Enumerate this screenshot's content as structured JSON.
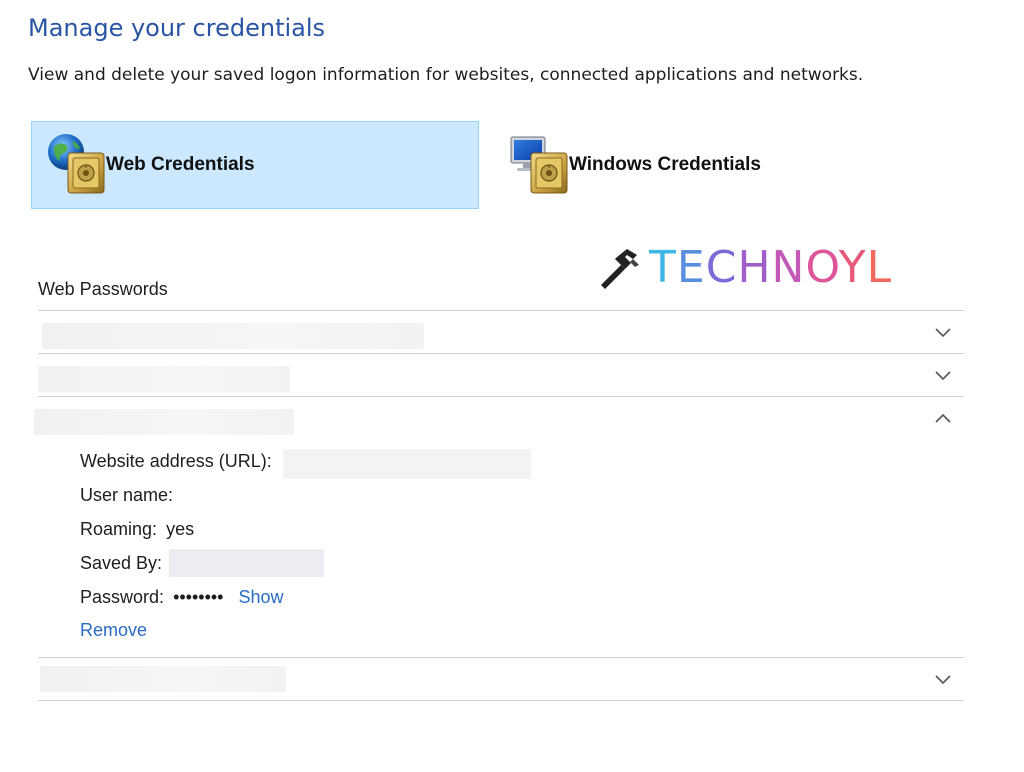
{
  "header": {
    "title": "Manage your credentials",
    "subtitle": "View and delete your saved logon information for websites, connected applications and networks."
  },
  "tiles": [
    {
      "label": "Web Credentials",
      "selected": true,
      "icon": "globe-vault-icon"
    },
    {
      "label": "Windows Credentials",
      "selected": false,
      "icon": "monitor-vault-icon"
    }
  ],
  "watermark": {
    "letters": [
      "T",
      "E",
      "C",
      "H",
      "N",
      "O",
      "Y",
      "L"
    ],
    "icon": "hammer-icon"
  },
  "section": {
    "title": "Web Passwords"
  },
  "entries": [
    {
      "expanded": false,
      "chevron": "chevron-down-icon"
    },
    {
      "expanded": false,
      "chevron": "chevron-down-icon"
    },
    {
      "expanded": true,
      "chevron": "chevron-up-icon",
      "details": {
        "url_label": "Website address (URL):",
        "username_label": "User name:",
        "roaming_label": "Roaming:",
        "roaming_value": "yes",
        "saved_by_label": "Saved By:",
        "password_label": "Password:",
        "password_value": "••••••••",
        "show_link": "Show",
        "remove_link": "Remove"
      }
    },
    {
      "expanded": false,
      "chevron": "chevron-down-icon"
    }
  ],
  "colors": {
    "title_blue": "#2a55a4",
    "link_blue": "#2a6cc4",
    "selected_tile_bg": "#cce8ff",
    "selected_tile_border": "#99d1ff"
  }
}
